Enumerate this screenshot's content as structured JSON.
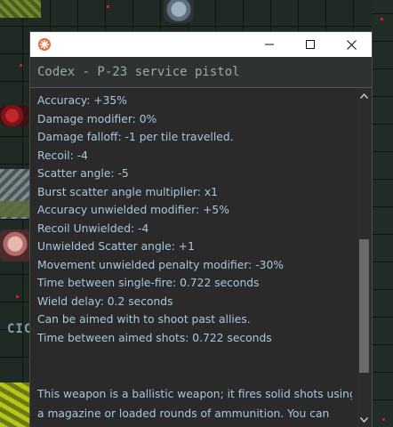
{
  "window": {
    "title_icon": "codex-app-icon",
    "controls": {
      "minimize": "minimize-icon",
      "maximize": "maximize-icon",
      "close": "close-icon"
    }
  },
  "header": {
    "title": "Codex - P-23 service pistol"
  },
  "stats": [
    "Accuracy: +35%",
    "Damage modifier: 0%",
    "Damage falloff: -1 per tile travelled.",
    "Recoil: -4",
    "Scatter angle: -5",
    "Burst scatter angle multiplier: x1",
    "Accuracy unwielded modifier: +5%",
    "Recoil Unwielded: -4",
    "Unwielded Scatter angle: +1",
    "Movement unwielded penalty modifier: -30%",
    "Time between single-fire: 0.722 seconds",
    "Wield delay: 0.2 seconds",
    "Can be aimed with to shoot past allies.",
    "Time between aimed shots: 0.722 seconds"
  ],
  "description": "This weapon is a ballistic weapon; it fires solid shots using a magazine or loaded rounds of ammunition. You can unload",
  "colors": {
    "text": "#a8c8dd",
    "header_text": "#9aa9ad",
    "panel_bg": "#2a2a2a",
    "icon_accent": "#ee6a3a"
  },
  "background_labels": {
    "left_sign": "CIC"
  }
}
